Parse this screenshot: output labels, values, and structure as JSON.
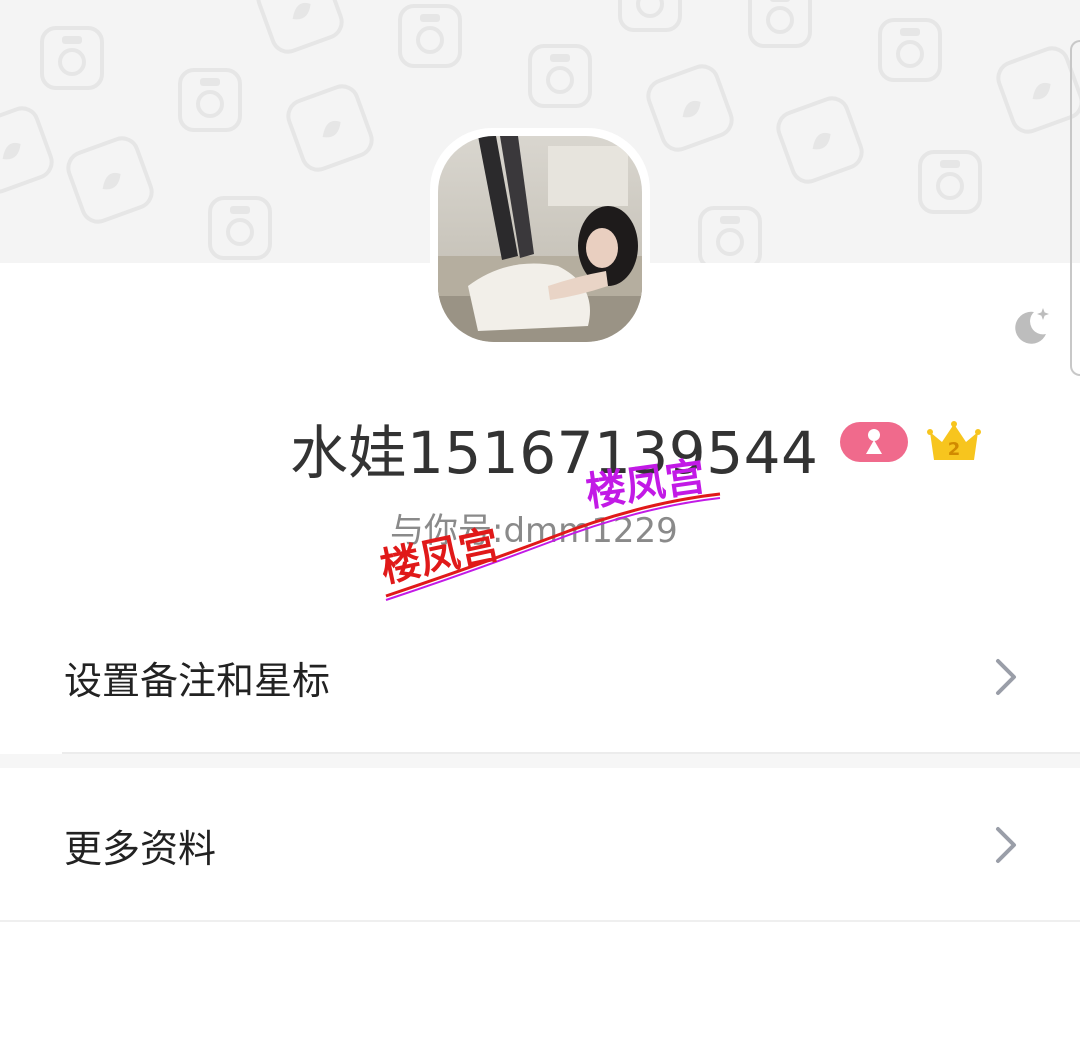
{
  "profile": {
    "name": "水娃15167139544",
    "account": "与你号:dmm1229"
  },
  "menu": [
    {
      "label": "设置备注和星标"
    },
    {
      "label": "更多资料"
    }
  ],
  "watermark": {
    "text_primary": "楼凤宫",
    "text_secondary": "楼凤宫",
    "color_primary": "#e01919",
    "color_secondary": "#c21ae6"
  },
  "badges": {
    "gender_color": "#f06a8c",
    "crown_level": "2",
    "crown_color": "#f7c51e"
  },
  "icons": [
    "camera-pattern-icon",
    "moon-star-icon",
    "gender-badge-icon",
    "crown-icon",
    "chevron-right-icon"
  ]
}
